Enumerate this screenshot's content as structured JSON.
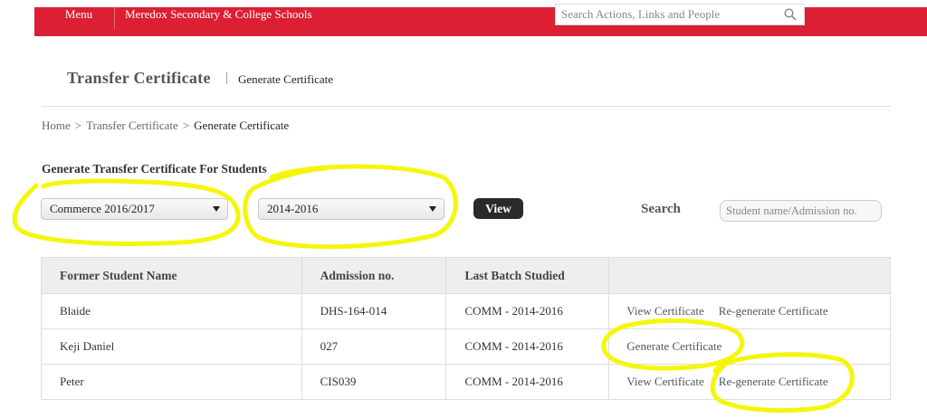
{
  "topbar": {
    "menu_label": "Menu",
    "school_name": "Meredox Secondary & College Schools",
    "search_placeholder": "Search Actions, Links and People"
  },
  "page": {
    "title": "Transfer Certificate",
    "separator": "|",
    "subtitle": "Generate Certificate"
  },
  "breadcrumb": {
    "items": [
      "Home",
      "Transfer Certificate",
      "Generate Certificate"
    ],
    "separator": ">"
  },
  "section_title": "Generate Transfer Certificate For Students",
  "filters": {
    "course_selected": "Commerce 2016/2017",
    "batch_selected": "2014-2016",
    "view_label": "View",
    "search_label": "Search",
    "search_placeholder": "Student name/Admission no."
  },
  "table": {
    "headers": [
      "Former Student Name",
      "Admission no.",
      "Last Batch Studied",
      ""
    ],
    "rows": [
      {
        "name": "Blaide",
        "admission": "DHS-164-014",
        "batch": "COMM - 2014-2016",
        "actions": [
          "View Certificate",
          "Re-generate Certificate"
        ]
      },
      {
        "name": "Keji Daniel",
        "admission": "027",
        "batch": "COMM - 2014-2016",
        "actions": [
          "Generate Certificate"
        ]
      },
      {
        "name": "Peter",
        "admission": "CIS039",
        "batch": "COMM - 2014-2016",
        "actions": [
          "View Certificate",
          "Re-generate Certificate"
        ]
      }
    ]
  },
  "colors": {
    "brand_red": "#dc1f33",
    "highlight_yellow": "#f5f500",
    "view_button": "#2a2a2a"
  }
}
